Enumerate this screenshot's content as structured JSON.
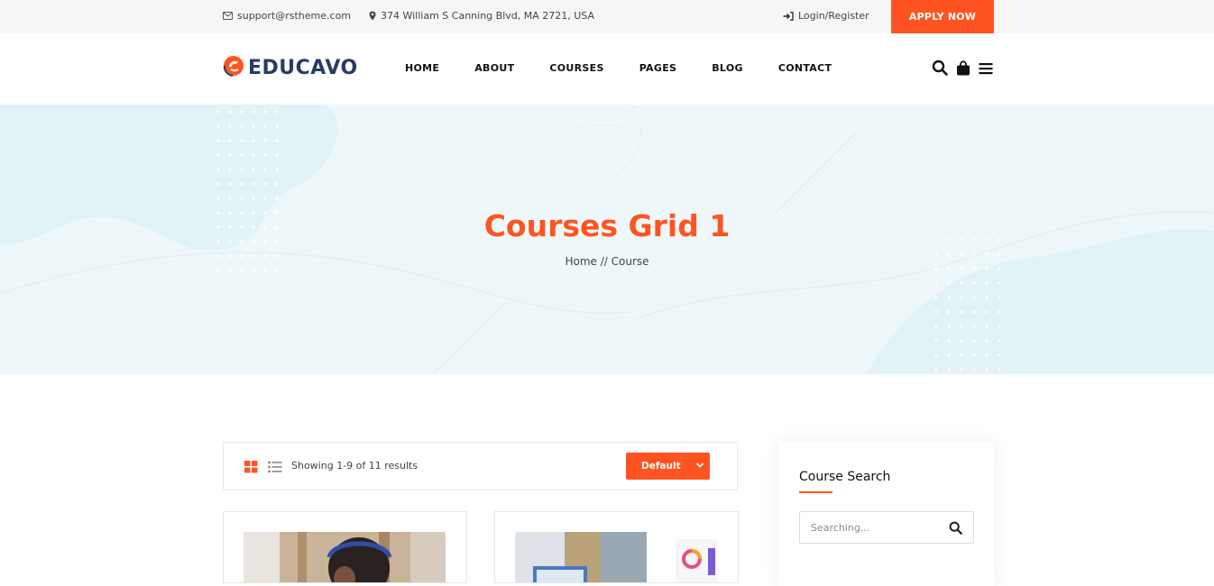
{
  "topbar": {
    "email": "support@rstheme.com",
    "address": "374 William S Canning Blvd, MA 2721, USA",
    "login_label": "Login/Register",
    "apply_label": "APPLY NOW"
  },
  "header": {
    "logo_text": "EDUCAVO",
    "nav": [
      "HOME",
      "ABOUT",
      "COURSES",
      "PAGES",
      "BLOG",
      "CONTACT"
    ],
    "icons": [
      "search-icon",
      "shopping-bag-icon",
      "menu-icon"
    ]
  },
  "hero": {
    "title": "Courses Grid 1",
    "breadcrumb": [
      "Home",
      "//",
      "Course"
    ]
  },
  "toolbar": {
    "results_text": "Showing 1-9 of 11 results",
    "sort_selected": "Default"
  },
  "sidebar": {
    "title": "Course Search",
    "search_placeholder": "Searching..."
  },
  "colors": {
    "accent": "#ff5421",
    "brand_navy": "#273c66",
    "hero_bg": "#eef8fb"
  }
}
